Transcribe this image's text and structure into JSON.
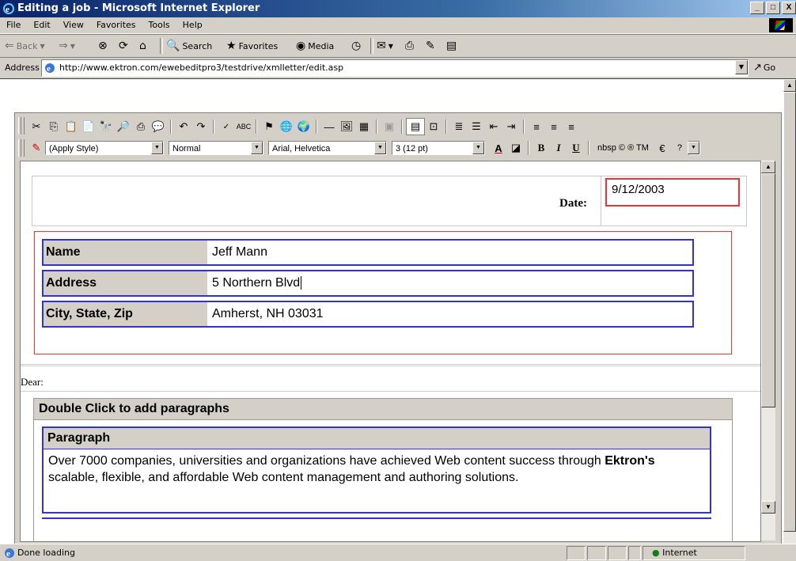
{
  "window": {
    "title": "Editing a job - Microsoft Internet Explorer",
    "buttons": {
      "minimize": "_",
      "restore": "□",
      "close": "X"
    }
  },
  "menubar": {
    "items": [
      "File",
      "Edit",
      "View",
      "Favorites",
      "Tools",
      "Help"
    ]
  },
  "toolbar": {
    "back": "Back",
    "search": "Search",
    "favorites": "Favorites",
    "media": "Media"
  },
  "addressbar": {
    "label": "Address",
    "url": "http://www.ektron.com/ewebeditpro3/testdrive/xmlletter/edit.asp",
    "go": "Go"
  },
  "editor": {
    "style_select": "(Apply Style)",
    "format_select": "Normal",
    "font_select": "Arial, Helvetica",
    "size_select": "3 (12 pt)",
    "bold": "B",
    "italic": "I",
    "underline": "U",
    "special_chars": "nbsp © ® TM",
    "euro": "€",
    "help": "?"
  },
  "document": {
    "date_label": "Date:",
    "date_value": "9/12/2003",
    "fields": [
      {
        "label": "Name",
        "value": "Jeff Mann"
      },
      {
        "label": "Address",
        "value": "5 Northern Blvd"
      },
      {
        "label": "City, State, Zip",
        "value": "Amherst, NH 03031"
      }
    ],
    "dear": "Dear:",
    "paragraphs_header": "Double Click to add paragraphs",
    "paragraph_header": "Paragraph",
    "paragraph_text_1": "Over 7000 companies, universities and organizations have achieved Web content success through ",
    "paragraph_bold": "Ektron's",
    "paragraph_text_2": " scalable, flexible, and affordable Web content management and authoring solutions."
  },
  "statusbar": {
    "message": "Done loading",
    "zone": "Internet"
  }
}
